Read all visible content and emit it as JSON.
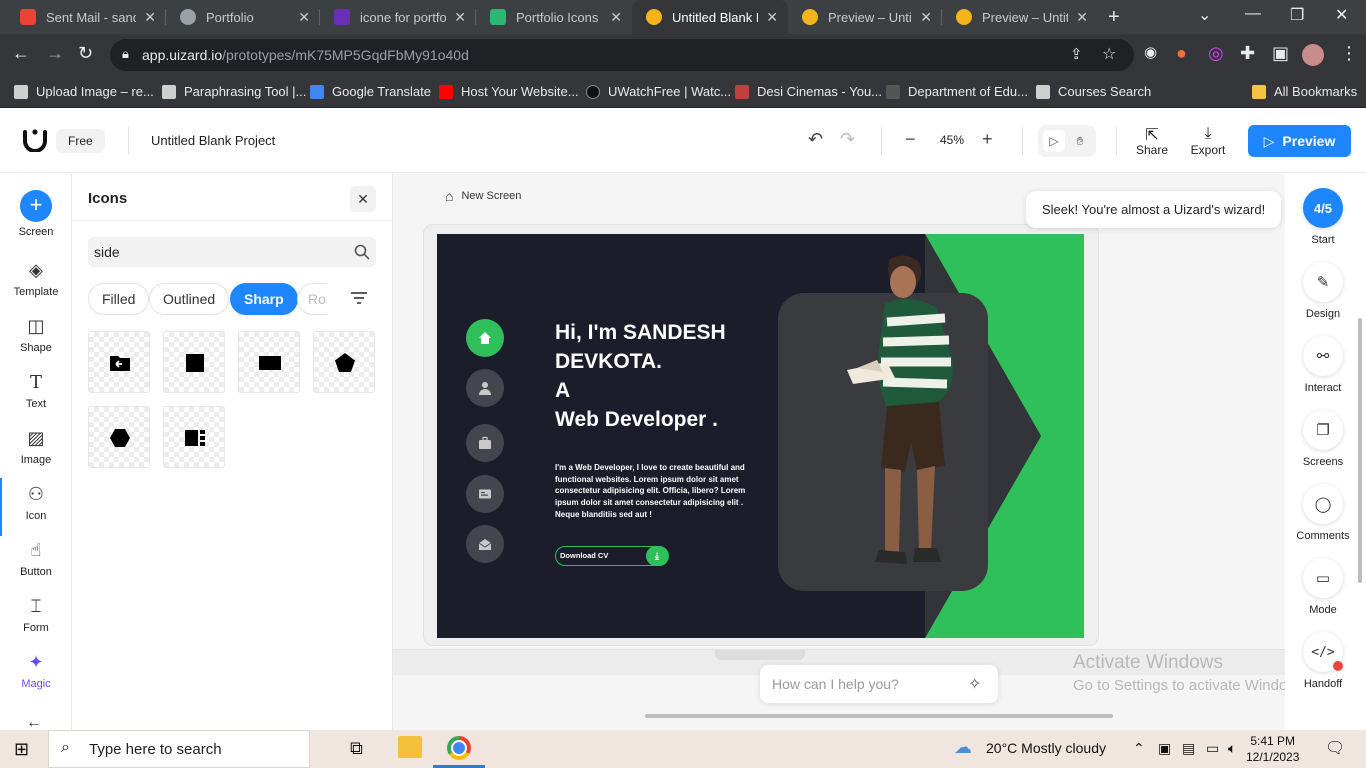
{
  "browser": {
    "tabs": [
      {
        "title": "Sent Mail - sandesh",
        "color": "#ea4335"
      },
      {
        "title": "Portfolio",
        "color": "#9aa0a6"
      },
      {
        "title": "icone for portfolio",
        "color": "#6b2fb3"
      },
      {
        "title": "Portfolio Icons & Symbols",
        "color": "#2bb673"
      },
      {
        "title": "Untitled Blank Project",
        "color": "#f5b41a"
      },
      {
        "title": "Preview – Untitled",
        "color": "#f5b41a"
      },
      {
        "title": "Preview – Untitled",
        "color": "#f5b41a"
      }
    ],
    "url_host": "app.uizard.io",
    "url_path": "/prototypes/mK75MP5GqdFbMy91o40d",
    "bookmarks": [
      {
        "label": "Upload Image – re...",
        "color": "#cfcfcf"
      },
      {
        "label": "Paraphrasing Tool |...",
        "color": "#cfcfcf"
      },
      {
        "label": "Google Translate",
        "color": "#4285f4"
      },
      {
        "label": "Host Your Website...",
        "color": "#ff0000"
      },
      {
        "label": "UWatchFree | Watc...",
        "color": "#111111"
      },
      {
        "label": "Desi Cinemas - You...",
        "color": "#c04040"
      },
      {
        "label": "Department of Edu...",
        "color": "#222222"
      },
      {
        "label": "Courses Search",
        "color": "#cfcfcf"
      }
    ],
    "all_bookmarks": "All Bookmarks"
  },
  "header": {
    "plan": "Free",
    "project_name": "Untitled Blank Project",
    "zoom": "45%",
    "share": "Share",
    "export": "Export",
    "preview": "Preview",
    "accent": "#1e86ff"
  },
  "rail": {
    "items": [
      "Screen",
      "Template",
      "Shape",
      "Text",
      "Image",
      "Icon",
      "Button",
      "Form",
      "Magic"
    ]
  },
  "panel": {
    "title": "Icons",
    "search_value": "side",
    "filters": [
      "Filled",
      "Outlined",
      "Sharp",
      "Round"
    ],
    "selected_filter": "Sharp"
  },
  "canvas": {
    "screen_name": "New Screen",
    "toast": "Sleek! You're almost a Uizard's wizard!",
    "ask_placeholder": "How can I help you?",
    "watermark_title": "Activate Windows",
    "watermark_sub": "Go to Settings to activate Windows.",
    "design": {
      "hero_lines": [
        "Hi, I'm SANDESH",
        "DEVKOTA.",
        "A",
        "Web Developer ."
      ],
      "paragraph": "I'm a Web Developer, I love to create beautiful and functional websites. Lorem ipsum dolor sit amet consectetur adipisicing elit. Officia, libero? Lorem ipsum dolor sit amet consectetur adipisicing elit . Neque blanditiis sed aut !",
      "cv_button": "Download CV",
      "accent": "#2fc05b",
      "background": "#1b1d2a"
    }
  },
  "right_rail": {
    "progress": "4/5",
    "items": [
      "Start",
      "Design",
      "Interact",
      "Screens",
      "Comments",
      "Mode",
      "Handoff"
    ]
  },
  "taskbar": {
    "search_placeholder": "Type here to search",
    "weather": "20°C  Mostly cloudy",
    "time": "5:41 PM",
    "date": "12/1/2023"
  }
}
